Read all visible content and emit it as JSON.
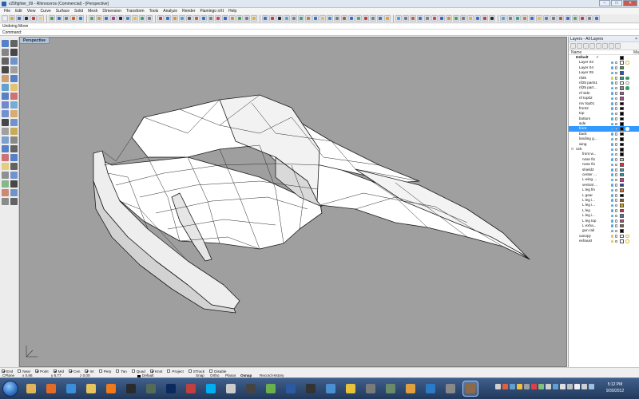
{
  "window": {
    "title": "v25fighter_09 - Rhinoceros (Commercial) - [Perspective]",
    "controls": [
      "−",
      "□",
      "✕"
    ]
  },
  "menubar": [
    "File",
    "Edit",
    "View",
    "Curve",
    "Surface",
    "Solid",
    "Mesh",
    "Dimension",
    "Transform",
    "Tools",
    "Analyze",
    "Render",
    "Flamingo nXt",
    "Help"
  ],
  "command": {
    "history": "Undoing Move",
    "prompt": "Command:"
  },
  "viewport": {
    "label": "Perspective",
    "background": "#9f9f9f"
  },
  "layers_panel": {
    "title": "Layers - All Layers",
    "close": "×",
    "header_name": "Name",
    "header_material": "Ma",
    "rows": [
      {
        "name": "Default",
        "indent": 0,
        "current": true,
        "color": "#000000",
        "material": "none",
        "bulb": "",
        "bold": true
      },
      {
        "name": "Layer 03",
        "indent": 1,
        "color": "#ffffff",
        "material": "ring",
        "bulb": "on"
      },
      {
        "name": "Layer 04",
        "indent": 1,
        "color": "#22aa22",
        "material": "none",
        "bulb": "on"
      },
      {
        "name": "Layer 05",
        "indent": 1,
        "color": "#2255cc",
        "material": "none",
        "bulb": "on"
      },
      {
        "name": "nf25",
        "indent": 1,
        "color": "#2aa38a",
        "material": "green",
        "bulb": "off"
      },
      {
        "name": "nf25 parts1",
        "indent": 1,
        "color": "#ffffff",
        "material": "white",
        "bulb": "on"
      },
      {
        "name": "nf25 part...",
        "indent": 1,
        "color": "#7f8f9f",
        "material": "green",
        "bulb": "on"
      },
      {
        "name": "nf side",
        "indent": 1,
        "color": "#c040c0",
        "material": "none",
        "bulb": "on"
      },
      {
        "name": "nf top02",
        "indent": 1,
        "color": "#c03aa0",
        "material": "none",
        "bulb": "on"
      },
      {
        "name": "nrv top01",
        "indent": 1,
        "color": "#000000",
        "material": "none",
        "bulb": "on"
      },
      {
        "name": "front2",
        "indent": 1,
        "color": "#000000",
        "material": "none",
        "bulb": "on"
      },
      {
        "name": "top",
        "indent": 1,
        "color": "#000000",
        "material": "none",
        "bulb": "on"
      },
      {
        "name": "bottom",
        "indent": 1,
        "color": "#000000",
        "material": "none",
        "bulb": "on"
      },
      {
        "name": "side",
        "indent": 1,
        "color": "#000000",
        "material": "none",
        "bulb": "on"
      },
      {
        "name": "front",
        "indent": 1,
        "color": "#000000",
        "material": "bwhite",
        "bulb": "on",
        "selected": true
      },
      {
        "name": "back",
        "indent": 1,
        "color": "#000000",
        "material": "none",
        "bulb": "on"
      },
      {
        "name": "landing g...",
        "indent": 1,
        "color": "#000000",
        "material": "none",
        "bulb": "on"
      },
      {
        "name": "wing",
        "indent": 1,
        "color": "#000000",
        "material": "none",
        "bulb": "on"
      },
      {
        "name": "v25",
        "indent": 0,
        "expander": "⊟",
        "color": "#000000",
        "material": "none",
        "bulb": "on"
      },
      {
        "name": "front w...",
        "indent": 2,
        "color": "#000000",
        "material": "none",
        "bulb": "on"
      },
      {
        "name": "nose fin",
        "indent": 2,
        "color": "#c0c0c0",
        "material": "none",
        "bulb": "on"
      },
      {
        "name": "nose fin",
        "indent": 2,
        "color": "#e03030",
        "material": "none",
        "bulb": "on"
      },
      {
        "name": "shield2",
        "indent": 2,
        "color": "#30a0b0",
        "material": "none",
        "bulb": "on"
      },
      {
        "name": "center ...",
        "indent": 2,
        "color": "#30a0a0",
        "material": "none",
        "bulb": "on"
      },
      {
        "name": "L wing ...",
        "indent": 2,
        "color": "#e03090",
        "material": "none",
        "bulb": "on"
      },
      {
        "name": "ventral ...",
        "indent": 2,
        "color": "#2040c0",
        "material": "none",
        "bulb": "on"
      },
      {
        "name": "L leg fin",
        "indent": 2,
        "color": "#d07020",
        "material": "none",
        "bulb": "on"
      },
      {
        "name": "L gear",
        "indent": 2,
        "color": "#000000",
        "material": "none",
        "bulb": "on"
      },
      {
        "name": "L leg i...",
        "indent": 2,
        "color": "#8a5a2a",
        "material": "none",
        "bulb": "on"
      },
      {
        "name": "L leg i...",
        "indent": 2,
        "color": "#c8a020",
        "material": "none",
        "bulb": "on"
      },
      {
        "name": "L leg",
        "indent": 2,
        "color": "#d03040",
        "material": "none",
        "bulb": "on"
      },
      {
        "name": "L leg i...",
        "indent": 2,
        "color": "#6070a0",
        "material": "none",
        "bulb": "on"
      },
      {
        "name": "L leg top",
        "indent": 2,
        "color": "#c04070",
        "material": "none",
        "bulb": "on"
      },
      {
        "name": "L exha...",
        "indent": 2,
        "color": "#a05050",
        "material": "none",
        "bulb": "on"
      },
      {
        "name": "gun rail",
        "indent": 2,
        "color": "#000000",
        "material": "none",
        "bulb": "on"
      },
      {
        "name": "canopy",
        "indent": 1,
        "color": "#ffffff",
        "material": "ring",
        "bulb": "off"
      },
      {
        "name": "exhaust",
        "indent": 1,
        "color": "#ffffff",
        "material": "ring",
        "bulb": "off"
      }
    ]
  },
  "osnaps": [
    {
      "label": "End",
      "checked": true
    },
    {
      "label": "Near",
      "checked": false
    },
    {
      "label": "Point",
      "checked": true
    },
    {
      "label": "Mid",
      "checked": true
    },
    {
      "label": "Cen",
      "checked": true
    },
    {
      "label": "Int",
      "checked": true
    },
    {
      "label": "Perp",
      "checked": false
    },
    {
      "label": "Tan",
      "checked": false
    },
    {
      "label": "Quad",
      "checked": false
    },
    {
      "label": "Knot",
      "checked": true
    },
    {
      "label": "Project",
      "checked": false
    },
    {
      "label": "STrack",
      "checked": false
    },
    {
      "label": "Disable",
      "checked": false
    }
  ],
  "status": {
    "cplane": "CPlane",
    "x": "x 0.86",
    "y": "y 6.77",
    "z": "z 0.00",
    "layer": "Default",
    "snap": "Snap",
    "ortho": "Ortho",
    "planar": "Planar",
    "osnap": "Osnap",
    "history": "Record History"
  },
  "taskbar": {
    "time": "5:12 PM",
    "date": "9/30/2012",
    "apps": [
      {
        "icon": "windows-explorer-icon",
        "color": "#e2b45a"
      },
      {
        "icon": "firefox-icon",
        "color": "#e46b25"
      },
      {
        "icon": "internet-explorer-icon",
        "color": "#3a8fd8"
      },
      {
        "icon": "folder-icon",
        "color": "#e8c45e"
      },
      {
        "icon": "media-player-icon",
        "color": "#f07a1a"
      },
      {
        "icon": "cinema4d-icon",
        "color": "#2b2b2b"
      },
      {
        "icon": "deviantart-icon",
        "color": "#556b5a"
      },
      {
        "icon": "photoshop-icon",
        "color": "#0a2a5e"
      },
      {
        "icon": "tool-icon",
        "color": "#c04040"
      },
      {
        "icon": "skype-icon",
        "color": "#00aff0"
      },
      {
        "icon": "sketchup-icon",
        "color": "#cccccc"
      },
      {
        "icon": "zbrush-icon",
        "color": "#444444"
      },
      {
        "icon": "maps-icon",
        "color": "#6ab04c"
      },
      {
        "icon": "ps-icon",
        "color": "#2c5aa0"
      },
      {
        "icon": "sixtyseven-icon",
        "color": "#333333"
      },
      {
        "icon": "app-icon",
        "color": "#4a90d0"
      },
      {
        "icon": "chrome-icon",
        "color": "#e8c33a"
      },
      {
        "icon": "calculator-icon",
        "color": "#7a7a7a"
      },
      {
        "icon": "magnifier-icon",
        "color": "#6a8a6a"
      },
      {
        "icon": "blender-icon",
        "color": "#e0a040"
      },
      {
        "icon": "skype2-icon",
        "color": "#2a7ac8"
      },
      {
        "icon": "gimp-icon",
        "color": "#888888"
      },
      {
        "icon": "rhino-icon",
        "color": "#8d6a48"
      }
    ]
  }
}
